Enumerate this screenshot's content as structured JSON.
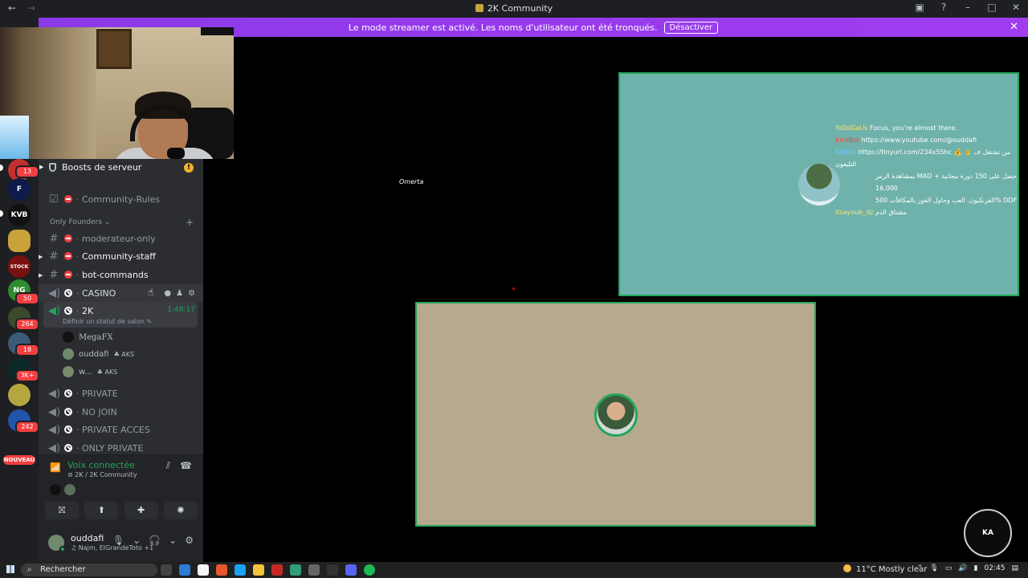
{
  "window": {
    "title": "2K Community",
    "nav_back": "←",
    "nav_forward": "→"
  },
  "banner": {
    "message": "Le mode streamer est activé. Les noms d'utilisateur ont été tronqués.",
    "button_label": "Désactiver"
  },
  "servers": [
    {
      "badge": "13",
      "color": "#c2312f"
    },
    {
      "label": "F",
      "color": "#0f1b4d"
    },
    {
      "label": "KVB",
      "color": "#111111"
    },
    {
      "label": "",
      "color": "#c9a23a"
    },
    {
      "label": "STOCK",
      "color": "#7a1111"
    },
    {
      "label": "NG",
      "badge": "50",
      "color": "#2e8b2e"
    },
    {
      "badge": "264",
      "color": "#3a4a2a"
    },
    {
      "badge": "18",
      "color": "#3c5a7a"
    },
    {
      "badge": "3K+",
      "color": "#0a2a2a"
    },
    {
      "label": "",
      "color": "#b5a640"
    },
    {
      "badge": "242",
      "color": "#2255aa"
    }
  ],
  "new_badge": "NOUVEAU",
  "sidebar": {
    "boosts": "Boosts de serveur",
    "rules_channel": "Community-Rules",
    "category": "Only Founders",
    "text_channels": [
      "moderateur-only",
      "Community-staff",
      "bot-commands"
    ],
    "voice_casino": "CASINO",
    "voice_active": "2K",
    "active_timer": "1:48:17",
    "status_hint": "Définir un statut de salon",
    "members": [
      {
        "name": "MegaFX",
        "tag": ""
      },
      {
        "name": "ouddafi",
        "tag": "AKS"
      },
      {
        "name": "w...",
        "tag": "AKS"
      }
    ],
    "voice_channels": [
      "PRIVATE",
      "NO JOIN",
      "PRIVATE ACCES",
      "ONLY PRIVATE"
    ]
  },
  "voice_panel": {
    "title": "Voix connectée",
    "location": "2K / 2K Community"
  },
  "user": {
    "name": "ouddafi",
    "status": "Najm, ElGrandeToto +1"
  },
  "stream": {
    "watermark": "Omerta",
    "chat": [
      {
        "user": "YoDiiGaUs",
        "text": "Focus, you're almost there."
      },
      {
        "user": "KickBot",
        "text": "https://www.youtube.com/@ouddafi"
      },
      {
        "user": "BotRix",
        "text": "https://tinyurl.com/234x55hc 💰 👌 من تشتغل ف التليفون"
      },
      {
        "user": "",
        "text": "بمشاهدة الرمز MAD حصل على 150 دورة مجانية + 16,000"
      },
      {
        "user": "",
        "text": "الفرنكيون. العب وحاول الفوز بالمكافآت 500% DDF"
      },
      {
        "user": "itsayoub_dz",
        "text": "مشتاق الدم"
      }
    ],
    "logo_text": "KA"
  },
  "taskbar": {
    "search": "Rechercher",
    "weather": "11°C  Mostly clear",
    "time": "02:45"
  }
}
